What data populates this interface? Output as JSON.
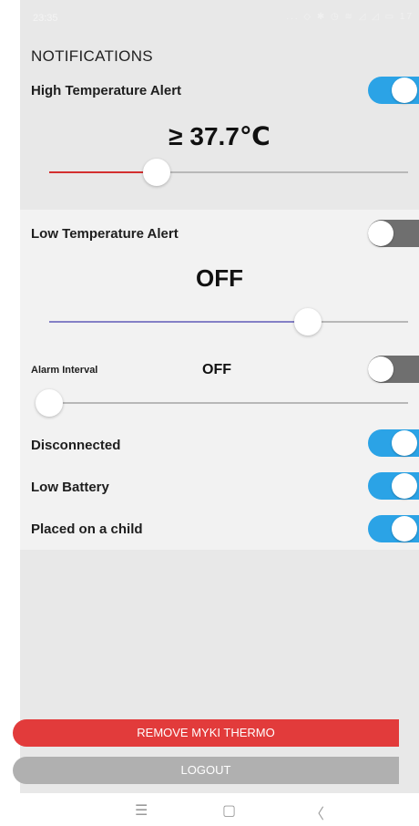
{
  "status_bar": {
    "time": "23:35",
    "icons": "... ◇ ✱ ◷ ≋ ◿ ◿ ▭ 17"
  },
  "screen_title": "NOTIFICATIONS",
  "high_temp": {
    "label": "High Temperature Alert",
    "enabled": true,
    "value": "≥ 37.7℃",
    "slider_level": 0.3,
    "accent": "#d32f2f"
  },
  "low_temp": {
    "label": "Low Temperature Alert",
    "enabled": false,
    "value": "OFF",
    "slider_level": 0.72,
    "accent": "#8480c6"
  },
  "alarm_interval": {
    "label": "Alarm Interval",
    "enabled": false,
    "value": "OFF",
    "slider_level": 0.0
  },
  "toggles": [
    {
      "label": "Disconnected",
      "enabled": true
    },
    {
      "label": "Low Battery",
      "enabled": true
    },
    {
      "label": "Placed on a child",
      "enabled": true
    }
  ],
  "buttons": {
    "remove": "REMOVE MYKI THERMO",
    "logout": "LOGOUT"
  },
  "navbar": {
    "menu": "☰",
    "home": "▢",
    "back": "〈"
  },
  "colors": {
    "toggle_on": "#2ba3e6",
    "toggle_off": "#6f6f6f",
    "remove_button": "#e23b3b",
    "logout_button": "#b0b0b0"
  }
}
